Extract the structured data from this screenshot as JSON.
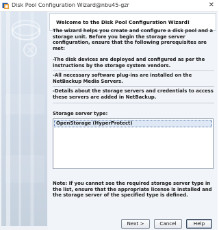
{
  "window": {
    "title": "Disk Pool Configuration Wizard@nbu45-gzr",
    "close_glyph": "✕",
    "icon": "netbackup-wizard-icon"
  },
  "banner": {
    "title": "Welcome to the Disk Pool Configuration Wizard!"
  },
  "intro": {
    "text": "The wizard helps you create and configure a disk pool and a storage unit. Before you begin the storage server configuration, ensure that the following prerequisites are met:"
  },
  "prerequisites": [
    "-The disk devices are deployed and configured as per the instructions by the storage system vendors.",
    "-All necessary software plug-ins are installed on the NetBackup Media Servers.",
    "-Details about the storage servers and credentials to access these servers are added in NetBackup."
  ],
  "storage_server_type": {
    "label": "Storage server type:",
    "options": [
      "OpenStorage (HyperProtect)"
    ],
    "selected_index": 0
  },
  "note": {
    "text": "Note: If you cannot see the required storage server type in the list, ensure that the appropriate license is installed and the storage server of the specified type is defined."
  },
  "buttons": {
    "next": "Next >",
    "cancel": "Cancel",
    "help": "Help"
  }
}
